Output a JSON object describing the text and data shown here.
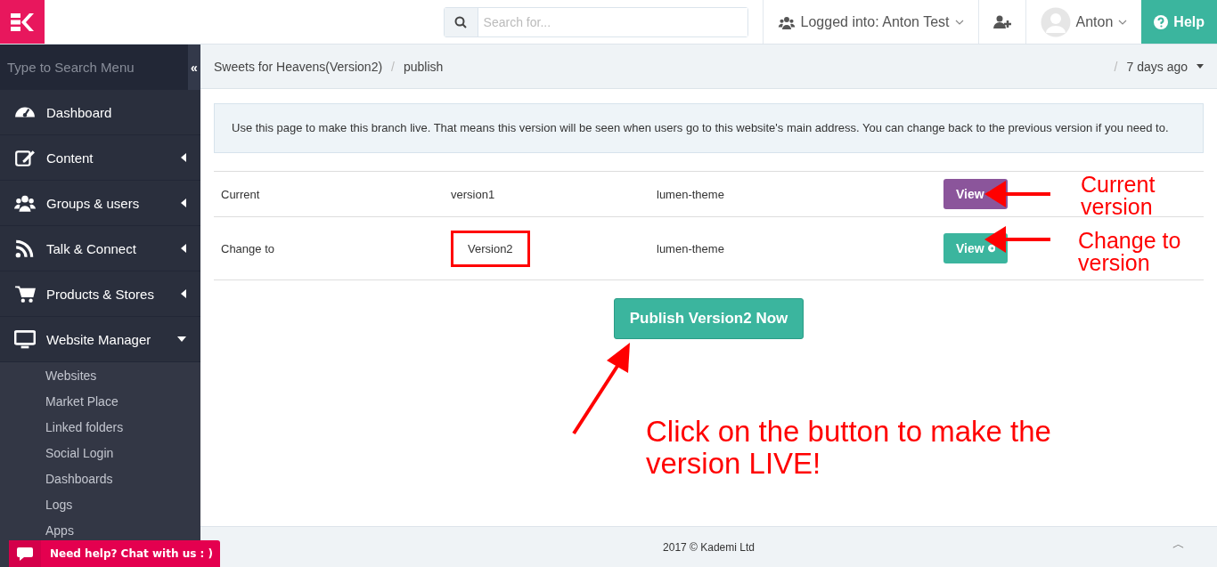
{
  "topbar": {
    "search": {
      "placeholder": "Search for..."
    },
    "account": "Logged into: Anton Test",
    "user": "Anton",
    "help": "Help"
  },
  "sidebar": {
    "search": {
      "placeholder": "Type to Search Menu"
    },
    "collapse": "«",
    "items": [
      {
        "label": "Dashboard",
        "kind": "link"
      },
      {
        "label": "Content",
        "kind": "group",
        "expanded": false
      },
      {
        "label": "Groups & users",
        "kind": "group",
        "expanded": false
      },
      {
        "label": "Talk & Connect",
        "kind": "group",
        "expanded": false
      },
      {
        "label": "Products & Stores",
        "kind": "group",
        "expanded": false
      },
      {
        "label": "Website Manager",
        "kind": "group",
        "expanded": true,
        "children": [
          {
            "label": "Websites"
          },
          {
            "label": "Market Place"
          },
          {
            "label": "Linked folders"
          },
          {
            "label": "Social Login"
          },
          {
            "label": "Dashboards"
          },
          {
            "label": "Logs"
          },
          {
            "label": "Apps"
          }
        ]
      }
    ]
  },
  "breadcrumb": {
    "items": [
      "Sweets for Heavens(Version2)",
      "publish"
    ],
    "separator": "/"
  },
  "updated": {
    "separator": "/",
    "label": "7 days ago"
  },
  "notice": "Use this page to make this branch live. That means this version will be seen when users go to this website's main address. You can change back to the previous version if you need to.",
  "rows": [
    {
      "label": "Current",
      "version": "version1",
      "highlighted": false,
      "theme": "lumen-theme",
      "button": "View",
      "color": "#8b559b",
      "note": "Current version"
    },
    {
      "label": "Change to",
      "version": "Version2",
      "highlighted": true,
      "theme": "lumen-theme",
      "button": "View",
      "color": "#3bb59e",
      "note": "Change to version"
    }
  ],
  "publish": "Publish Version2 Now",
  "callout": "Click on the button to make the version LIVE!",
  "footer": "2017 © Kademi Ltd",
  "scroll_top": "︿",
  "chat": "Need help? Chat with us : )"
}
